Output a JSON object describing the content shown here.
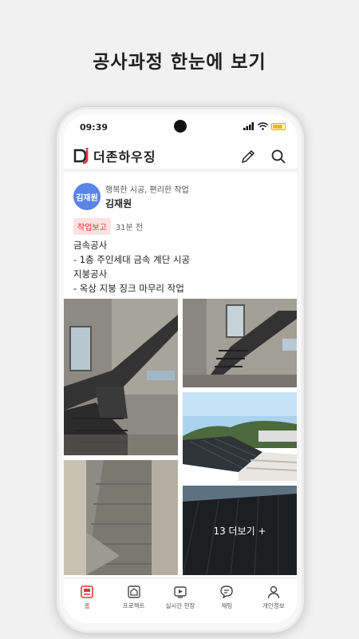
{
  "headline": "공사과정 한눈에 보기",
  "status_bar": {
    "time": "09:39"
  },
  "app": {
    "brand": "더존하우징"
  },
  "post": {
    "author_avatar": "김재원",
    "author_slogan": "행복한 시공, 편리한 작업",
    "author_name": "김재원",
    "tag": "작업보고",
    "time_ago": "31분 전",
    "lines": [
      "금속공사",
      "- 1층 주인세대 금속 계단 시공",
      "지붕공사",
      "- 옥상 지붕 징크 마무리 작업"
    ],
    "more_label": "13 더보기 +"
  },
  "tabs": [
    {
      "label": "홈",
      "icon": "home-icon"
    },
    {
      "label": "프로젝트",
      "icon": "project-icon"
    },
    {
      "label": "실시간 현장",
      "icon": "live-play-icon"
    },
    {
      "label": "채팅",
      "icon": "chat-icon"
    },
    {
      "label": "개인정보",
      "icon": "profile-icon"
    }
  ],
  "colors": {
    "accent": "#d33c3c",
    "avatar": "#5b84e8",
    "tag_bg": "#fde2e2"
  }
}
